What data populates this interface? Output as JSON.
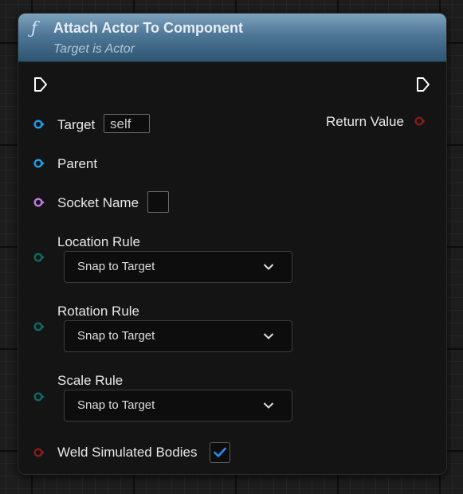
{
  "node": {
    "icon": "function-icon",
    "title": "Attach Actor To Component",
    "subtitle": "Target is Actor"
  },
  "pins": {
    "target": {
      "label": "Target",
      "default_value": "self",
      "color": "#1aa0ea"
    },
    "parent": {
      "label": "Parent",
      "color": "#1aa0ea"
    },
    "socket_name": {
      "label": "Socket Name",
      "default_value": "",
      "color": "#c07ce8"
    },
    "location_rule": {
      "label": "Location Rule",
      "value": "Snap to Target",
      "color": "#0b6b65"
    },
    "rotation_rule": {
      "label": "Rotation Rule",
      "value": "Snap to Target",
      "color": "#0b6b65"
    },
    "scale_rule": {
      "label": "Scale Rule",
      "value": "Snap to Target",
      "color": "#0b6b65"
    },
    "weld_simulated_bodies": {
      "label": "Weld Simulated Bodies",
      "checked": true,
      "color": "#8a1a1a"
    },
    "return_value": {
      "label": "Return Value",
      "color": "#8a1a1a"
    }
  },
  "colors": {
    "header_top": "#7da2bd",
    "header_bottom": "#2e5672",
    "node_body": "#141414",
    "checkmark": "#2a8de8"
  }
}
